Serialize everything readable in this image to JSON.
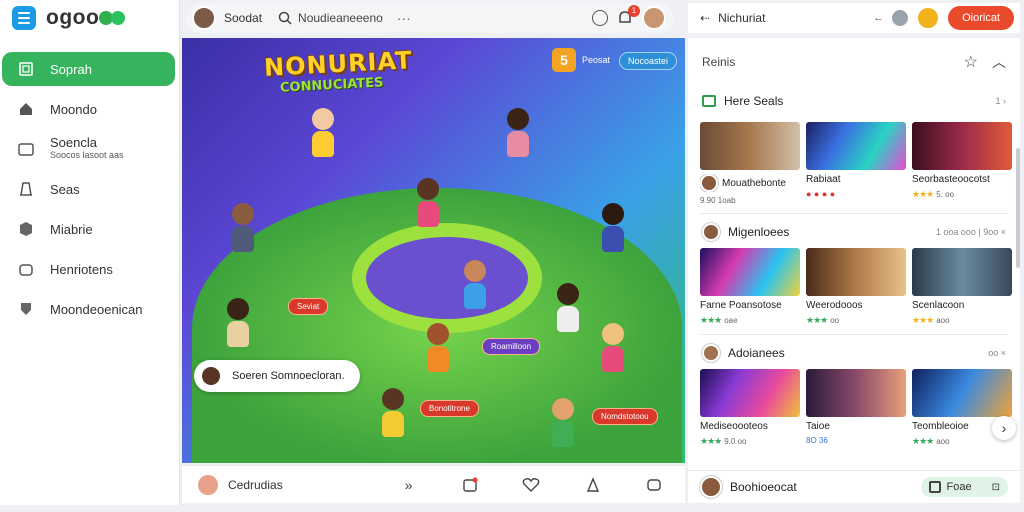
{
  "app": {
    "brand": "ogoo"
  },
  "sidebar": {
    "items": [
      {
        "label": "Soprah",
        "sub": "",
        "icon": "square-icon",
        "active": true
      },
      {
        "label": "Moondo",
        "sub": "",
        "icon": "home-icon",
        "active": false
      },
      {
        "label": "Soencla",
        "sub": "Soocos lasoot aas",
        "icon": "folder-icon",
        "active": false
      },
      {
        "label": "Seas",
        "sub": "",
        "icon": "document-icon",
        "active": false
      },
      {
        "label": "Miabrie",
        "sub": "",
        "icon": "box-icon",
        "active": false
      },
      {
        "label": "Henriotens",
        "sub": "",
        "icon": "bag-icon",
        "active": false
      },
      {
        "label": "Moondeoenican",
        "sub": "",
        "icon": "shield-icon",
        "active": false
      }
    ]
  },
  "topbar": {
    "user_name": "Soodat",
    "search_text": "Noudieaneeeno",
    "dots": "···",
    "notif_count": "1"
  },
  "hero": {
    "title": "NONURIAT",
    "subtitle": "CONNUCIATES",
    "top_chip": "Nocoastei",
    "top_chip_pre": "Peosat",
    "badge": "5",
    "tags": [
      "Seviat",
      "Roamilloon",
      "Bonotitrone",
      "Nomdstotoou"
    ],
    "comment": "Soeren Somnoecloran."
  },
  "bottombar": {
    "channel_name": "Cedrudias"
  },
  "right_top": {
    "title": "Nichuriat",
    "action": "Oioricat"
  },
  "right": {
    "header": "Reinis",
    "section1": {
      "title": "Here Seals",
      "meta": "1 ›",
      "cards": [
        {
          "title": "Mouathebonte",
          "meta": "9.90 1oab"
        },
        {
          "title": "Rabiaat",
          "meta": ""
        },
        {
          "title": "Seorbasteoocotst",
          "meta": "5. oo"
        }
      ]
    },
    "section2": {
      "title": "Migenloees",
      "meta": "1 ooa ooo | 9oo ×",
      "cards": [
        {
          "title": "Farne Poansotose",
          "meta": "oae"
        },
        {
          "title": "Weerodooos",
          "meta": "oo"
        },
        {
          "title": "Scenlacoon",
          "meta": "aoo"
        }
      ]
    },
    "section3": {
      "title": "Adoianees",
      "meta": "oo ×",
      "cards": [
        {
          "title": "Mediseoooteos",
          "meta": "9.0 oo"
        },
        {
          "title": "Taioe",
          "meta": "8O 36"
        },
        {
          "title": "Teombleoioe",
          "meta": "aoo"
        }
      ]
    },
    "bottom": {
      "label": "Boohioeocat",
      "pill_label": "Foae"
    }
  },
  "colors": {
    "accent_green": "#35b45d",
    "accent_red": "#e94a2c",
    "accent_blue": "#1a9be6"
  }
}
